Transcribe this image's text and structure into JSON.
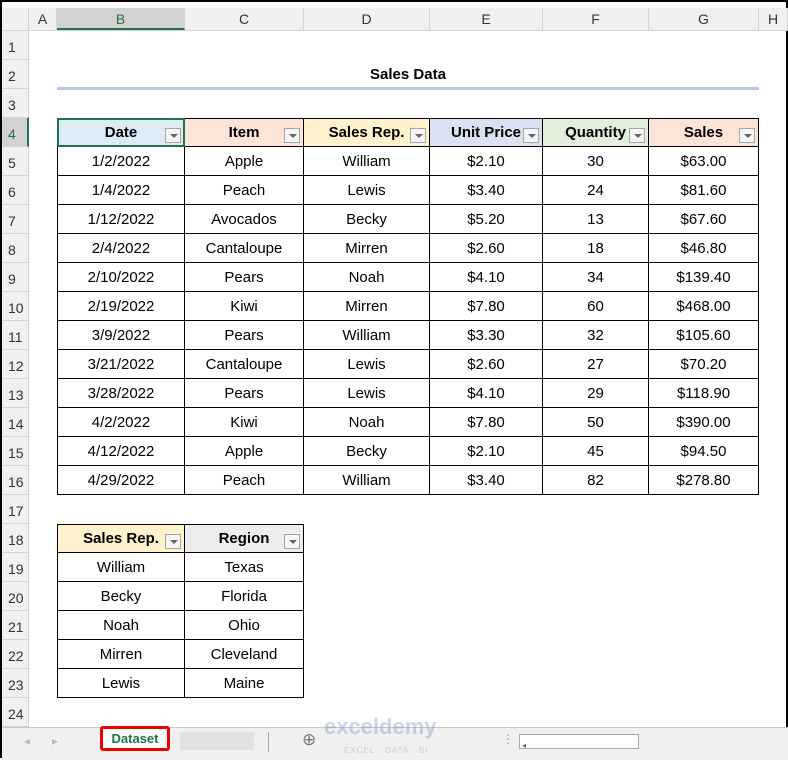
{
  "columns": [
    "A",
    "B",
    "C",
    "D",
    "E",
    "F",
    "G",
    "H"
  ],
  "rows": [
    "1",
    "2",
    "3",
    "4",
    "5",
    "6",
    "7",
    "8",
    "9",
    "10",
    "11",
    "12",
    "13",
    "14",
    "15",
    "16",
    "17",
    "18",
    "19",
    "20",
    "21",
    "22",
    "23",
    "24"
  ],
  "title": "Sales Data",
  "sales_table": {
    "headers": [
      "Date",
      "Item",
      "Sales Rep.",
      "Unit Price",
      "Quantity",
      "Sales"
    ],
    "header_colors": [
      "#DDEBF7",
      "#FCE4D6",
      "#FFF2CC",
      "#D9E1F2",
      "#E2EFDA",
      "#FCE4D6"
    ],
    "rows": [
      [
        "1/2/2022",
        "Apple",
        "William",
        "$2.10",
        "30",
        "$63.00"
      ],
      [
        "1/4/2022",
        "Peach",
        "Lewis",
        "$3.40",
        "24",
        "$81.60"
      ],
      [
        "1/12/2022",
        "Avocados",
        "Becky",
        "$5.20",
        "13",
        "$67.60"
      ],
      [
        "2/4/2022",
        "Cantaloupe",
        "Mirren",
        "$2.60",
        "18",
        "$46.80"
      ],
      [
        "2/10/2022",
        "Pears",
        "Noah",
        "$4.10",
        "34",
        "$139.40"
      ],
      [
        "2/19/2022",
        "Kiwi",
        "Mirren",
        "$7.80",
        "60",
        "$468.00"
      ],
      [
        "3/9/2022",
        "Pears",
        "William",
        "$3.30",
        "32",
        "$105.60"
      ],
      [
        "3/21/2022",
        "Cantaloupe",
        "Lewis",
        "$2.60",
        "27",
        "$70.20"
      ],
      [
        "3/28/2022",
        "Pears",
        "Lewis",
        "$4.10",
        "29",
        "$118.90"
      ],
      [
        "4/2/2022",
        "Kiwi",
        "Noah",
        "$7.80",
        "50",
        "$390.00"
      ],
      [
        "4/12/2022",
        "Apple",
        "Becky",
        "$2.10",
        "45",
        "$94.50"
      ],
      [
        "4/29/2022",
        "Peach",
        "William",
        "$3.40",
        "82",
        "$278.80"
      ]
    ]
  },
  "region_table": {
    "headers": [
      "Sales Rep.",
      "Region"
    ],
    "header_colors": [
      "#FFF2CC",
      "#EDEDED"
    ],
    "rows": [
      [
        "William",
        "Texas"
      ],
      [
        "Becky",
        "Florida"
      ],
      [
        "Noah",
        "Ohio"
      ],
      [
        "Mirren",
        "Cleveland"
      ],
      [
        "Lewis",
        "Maine"
      ]
    ]
  },
  "sheet_tab": "Dataset",
  "watermark": {
    "name": "exceldemy",
    "tagline": "EXCEL · DATA · BI"
  }
}
